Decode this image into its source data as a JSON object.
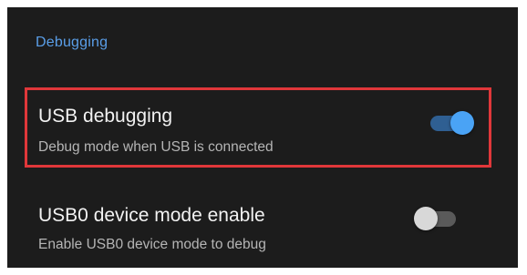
{
  "section": {
    "title": "Debugging",
    "title_color": "#5a9ee8"
  },
  "settings": [
    {
      "title": "USB debugging",
      "summary": "Debug mode when USB is connected",
      "enabled": true,
      "highlighted": true
    },
    {
      "title": "USB0 device mode enable",
      "summary": "Enable USB0 device mode to debug",
      "enabled": false,
      "highlighted": false
    }
  ],
  "colors": {
    "background": "#1c1c1c",
    "highlight_border": "#e0373a",
    "switch_on_thumb": "#4aa3f5",
    "switch_on_track": "#2f5f92",
    "switch_off_thumb": "#d8d8d8",
    "switch_off_track": "#5a5a5a"
  }
}
